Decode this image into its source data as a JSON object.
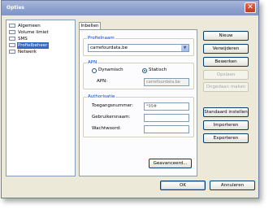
{
  "window": {
    "title": "Opties",
    "close_glyph": "✕"
  },
  "nav": {
    "items": [
      {
        "label": "Algemeen",
        "selected": false
      },
      {
        "label": "Volume limiet",
        "selected": false
      },
      {
        "label": "SMS",
        "selected": false
      },
      {
        "label": "Profielbeheer",
        "selected": true
      },
      {
        "label": "Netwerk",
        "selected": false
      }
    ]
  },
  "tab": {
    "label": "Inbellen"
  },
  "profile": {
    "group_label": "Profielnaam",
    "selected": "carrefourdata.be",
    "arrow_icon": "chevron-down-icon"
  },
  "apn": {
    "group_label": "APN",
    "option_dynamic": "Dynamisch",
    "option_static": "Statisch",
    "selected": "Statisch",
    "field_label": "APN:",
    "value": "carrefourdata.be"
  },
  "auth": {
    "group_label": "Authorisatie",
    "phone_label": "Toegangsnummer:",
    "phone_value": "*99#",
    "user_label": "Gebruikersnaam:",
    "user_value": "",
    "password_label": "Wachtwoord:",
    "password_value": ""
  },
  "advanced_button": "Geavanceerd...",
  "side_buttons": {
    "new": "Nieuw",
    "delete": "Verwijderen",
    "edit": "Bewerken",
    "save": "Opslaan",
    "undo": "Ongedaan maken",
    "defaults": "Standaard instellen",
    "import": "Importeren",
    "export": "Exporteren"
  },
  "footer": {
    "ok": "OK",
    "cancel": "Annuleren"
  }
}
